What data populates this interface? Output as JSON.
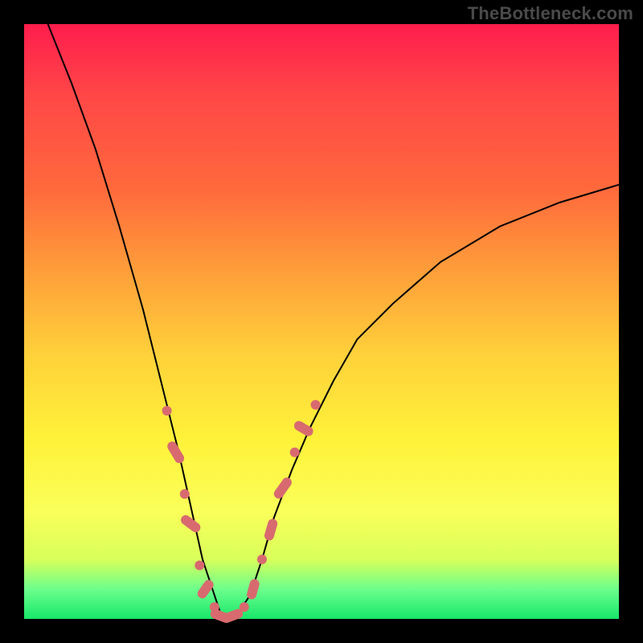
{
  "watermark": "TheBottleneck.com",
  "colors": {
    "page_bg": "#000000",
    "curve": "#000000",
    "marker": "#d86a6f"
  },
  "chart_data": {
    "type": "line",
    "title": "",
    "xlabel": "",
    "ylabel": "",
    "axes_visible": false,
    "background": {
      "kind": "vertical-gradient",
      "note": "Color encodes bottleneck severity; red (top) = bad, green (bottom) = good. No numeric axes shown.",
      "gradient_stops": [
        {
          "pos": 0.0,
          "color": "#ff1d4d"
        },
        {
          "pos": 0.12,
          "color": "#ff4747"
        },
        {
          "pos": 0.28,
          "color": "#ff6a3c"
        },
        {
          "pos": 0.42,
          "color": "#ffa03a"
        },
        {
          "pos": 0.56,
          "color": "#ffd23a"
        },
        {
          "pos": 0.7,
          "color": "#fff23a"
        },
        {
          "pos": 0.82,
          "color": "#faff5a"
        },
        {
          "pos": 0.9,
          "color": "#d8ff5a"
        },
        {
          "pos": 0.95,
          "color": "#6cff8c"
        },
        {
          "pos": 1.0,
          "color": "#18e66a"
        }
      ]
    },
    "xlim": [
      0,
      100
    ],
    "ylim": [
      0,
      100
    ],
    "series": [
      {
        "name": "bottleneck-curve",
        "note": "V-shaped curve; minimum near x≈34. Values are normalized 0–100, y=0 at bottom (green), y=100 at top (red).",
        "x": [
          4,
          8,
          12,
          16,
          20,
          23,
          26,
          28,
          30,
          32,
          33,
          34,
          35,
          36,
          38,
          40,
          42,
          45,
          48,
          52,
          56,
          62,
          70,
          80,
          90,
          100
        ],
        "y": [
          100,
          90,
          79,
          66,
          52,
          40,
          28,
          19,
          10,
          4,
          1,
          0,
          0,
          1,
          4,
          10,
          17,
          25,
          32,
          40,
          47,
          53,
          60,
          66,
          70,
          73
        ]
      }
    ],
    "markers": {
      "name": "highlighted-range",
      "style": "pill-dots",
      "color": "#d86a6f",
      "note": "clusters along both flanks of the curve near the bottom and at the trough",
      "points": [
        {
          "x": 24,
          "y": 35
        },
        {
          "x": 25.5,
          "y": 28,
          "len": 6
        },
        {
          "x": 27,
          "y": 21
        },
        {
          "x": 28,
          "y": 16,
          "len": 5
        },
        {
          "x": 29.5,
          "y": 9
        },
        {
          "x": 30.5,
          "y": 5,
          "len": 4
        },
        {
          "x": 32,
          "y": 2
        },
        {
          "x": 33,
          "y": 0.5,
          "len": 4
        },
        {
          "x": 35,
          "y": 0.5,
          "len": 5
        },
        {
          "x": 37,
          "y": 2
        },
        {
          "x": 38.5,
          "y": 5,
          "len": 4
        },
        {
          "x": 40,
          "y": 10
        },
        {
          "x": 41.5,
          "y": 15,
          "len": 5
        },
        {
          "x": 43.5,
          "y": 22,
          "len": 6
        },
        {
          "x": 45.5,
          "y": 28
        },
        {
          "x": 47,
          "y": 32,
          "len": 4
        },
        {
          "x": 49,
          "y": 36
        }
      ]
    }
  }
}
